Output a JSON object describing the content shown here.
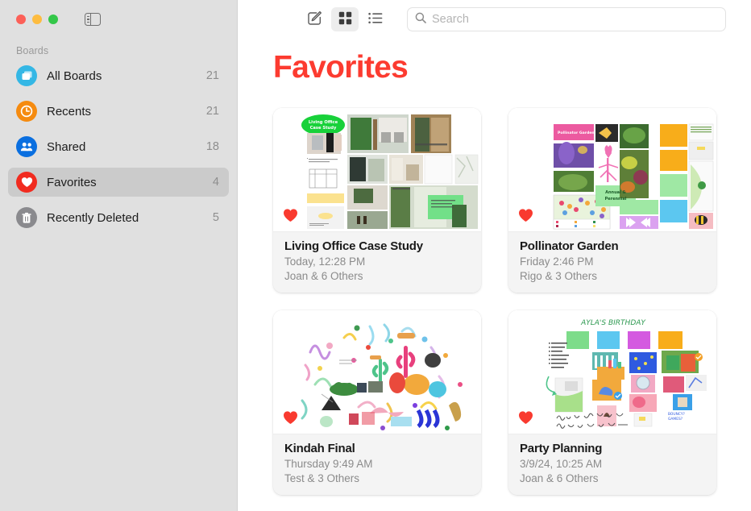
{
  "window": {
    "traffic_lights": [
      {
        "name": "close",
        "color": "#fc6058"
      },
      {
        "name": "minimize",
        "color": "#fdbc40"
      },
      {
        "name": "maximize",
        "color": "#34c749"
      }
    ],
    "sidebar_toggle_icon": "sidebar-toggle-icon"
  },
  "sidebar": {
    "section_label": "Boards",
    "items": [
      {
        "label": "All Boards",
        "count": "21",
        "icon": "boards-icon",
        "color": "#34b7e5",
        "selected": false
      },
      {
        "label": "Recents",
        "count": "21",
        "icon": "clock-icon",
        "color": "#f58b10",
        "selected": false
      },
      {
        "label": "Shared",
        "count": "18",
        "icon": "people-icon",
        "color": "#0a6fe0",
        "selected": false
      },
      {
        "label": "Favorites",
        "count": "4",
        "icon": "heart-icon",
        "color": "#f12b1f",
        "selected": true
      },
      {
        "label": "Recently Deleted",
        "count": "5",
        "icon": "trash-icon",
        "color": "#8a8a8e",
        "selected": false
      }
    ]
  },
  "toolbar": {
    "compose_label": "compose-icon",
    "grid_view_label": "grid-view-icon",
    "list_view_label": "list-view-icon",
    "active_view": "grid",
    "search_placeholder": "Search"
  },
  "main": {
    "title": "Favorites",
    "title_color": "#fc3b30",
    "boards": [
      {
        "title": "Living Office Case Study",
        "date": "Today, 12:28 PM",
        "people": "Joan & 6 Others",
        "favorite": true,
        "thumb": "living-office-board-thumbnail"
      },
      {
        "title": "Pollinator Garden",
        "date": "Friday 2:46 PM",
        "people": "Rigo & 3 Others",
        "favorite": true,
        "thumb": "pollinator-garden-board-thumbnail"
      },
      {
        "title": "Kindah Final",
        "date": "Thursday 9:49 AM",
        "people": "Test & 3 Others",
        "favorite": true,
        "thumb": "kindah-final-board-thumbnail"
      },
      {
        "title": "Party Planning",
        "date": "3/9/24, 10:25 AM",
        "people": "Joan & 6 Others",
        "favorite": true,
        "thumb": "party-planning-board-thumbnail"
      }
    ]
  }
}
